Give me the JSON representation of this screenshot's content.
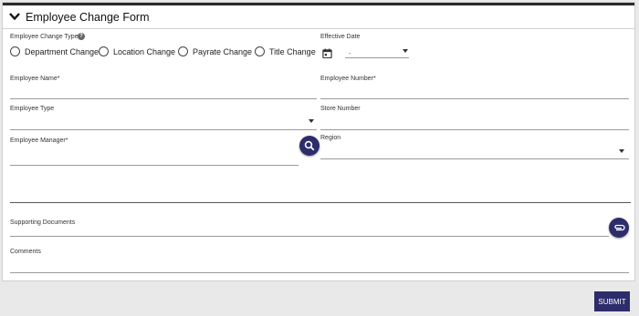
{
  "form": {
    "title": "Employee Change Form",
    "change_type_label": "Employee Change Type*",
    "change_type_options": [
      "Department Change",
      "Location Change",
      "Payrate Change",
      "Title Change"
    ],
    "effective_date_label": "Effective Date",
    "effective_date_value": "-",
    "employee_name_label": "Employee Name*",
    "employee_number_label": "Employee Number*",
    "employee_type_label": "Employee Type",
    "store_number_label": "Store Number",
    "employee_manager_label": "Employee Manager*",
    "region_label": "Region",
    "supporting_documents_label": "Supporting Documents",
    "comments_label": "Comments",
    "submit_label": "SUBMIT"
  },
  "icons": {
    "collapse": "chevron-down-icon",
    "help": "help-icon",
    "calendar": "calendar-icon",
    "search": "search-icon",
    "attach": "paperclip-icon"
  },
  "colors": {
    "accent": "#2d2d6b",
    "topbar": "#2b2b2b"
  }
}
